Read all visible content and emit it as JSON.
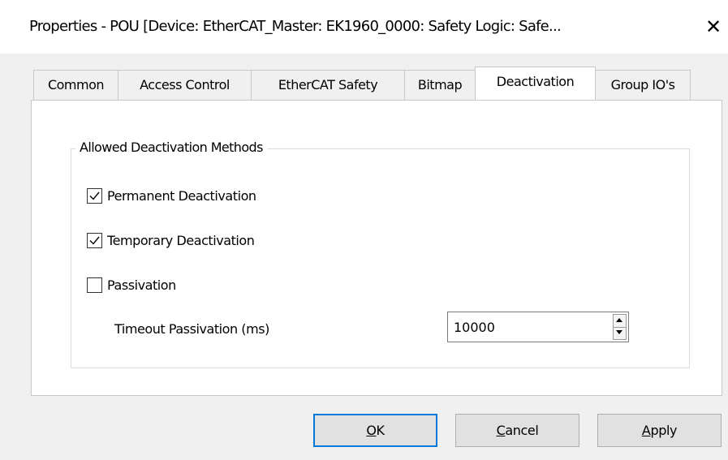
{
  "window": {
    "title": "Properties - POU [Device: EtherCAT_Master: EK1960_0000: Safety Logic: Safe...",
    "close_glyph": "✕"
  },
  "tabs": [
    {
      "label": "Common",
      "active": false
    },
    {
      "label": "Access Control",
      "active": false
    },
    {
      "label": "EtherCAT Safety",
      "active": false
    },
    {
      "label": "Bitmap",
      "active": false
    },
    {
      "label": "Deactivation",
      "active": true
    },
    {
      "label": "Group IO's",
      "active": false
    }
  ],
  "group": {
    "legend": "Allowed Deactivation Methods"
  },
  "options": [
    {
      "label": "Permanent Deactivation",
      "checked": true
    },
    {
      "label": "Temporary Deactivation",
      "checked": true
    },
    {
      "label": "Passivation",
      "checked": false
    }
  ],
  "timeout": {
    "label": "Timeout Passivation (ms)",
    "value": "10000"
  },
  "buttons": {
    "ok": {
      "mnemonic": "O",
      "rest": "K"
    },
    "cancel": {
      "mnemonic": "C",
      "rest": "ancel"
    },
    "apply": {
      "mnemonic": "A",
      "rest": "pply"
    }
  },
  "colors": {
    "focus_border": "#0078d7",
    "dialog_bg": "#f0f0f0",
    "panel_bg": "#ffffff"
  },
  "icons": {
    "close": "close-icon",
    "check": "checkmark-icon",
    "spin_up": "arrow-up-icon",
    "spin_down": "arrow-down-icon"
  }
}
